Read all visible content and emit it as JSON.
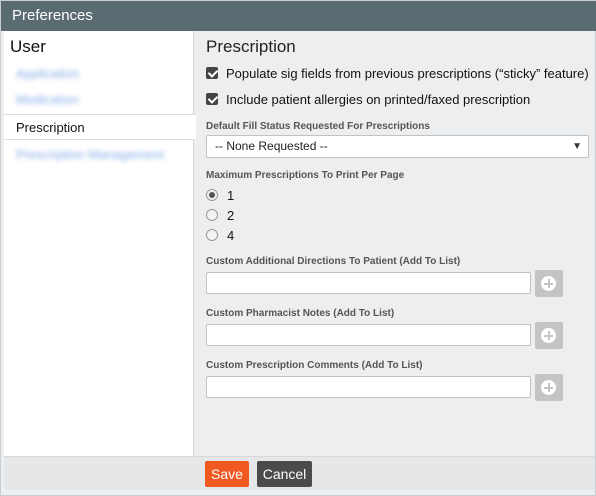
{
  "window": {
    "title": "Preferences"
  },
  "sidebar": {
    "heading": "User",
    "items": [
      {
        "label": "Application",
        "state": "blurred"
      },
      {
        "label": "Medication",
        "state": "blurred"
      },
      {
        "label": "Prescription",
        "state": "active"
      },
      {
        "label": "Prescription Management",
        "state": "blurred"
      }
    ]
  },
  "main": {
    "title": "Prescription",
    "checkboxes": [
      {
        "label": "Populate sig fields from previous prescriptions (“sticky” feature)",
        "checked": true
      },
      {
        "label": "Include patient allergies on printed/faxed prescription",
        "checked": true
      }
    ],
    "fill_status": {
      "label": "Default Fill Status Requested For Prescriptions",
      "value": "-- None Requested --"
    },
    "max_print": {
      "label": "Maximum Prescriptions To Print Per Page",
      "options": [
        "1",
        "2",
        "4"
      ],
      "selected": "1"
    },
    "directions": {
      "label": "Custom Additional Directions To Patient (Add To List)",
      "value": ""
    },
    "pharmacist_notes": {
      "label": "Custom Pharmacist Notes (Add To List)",
      "value": ""
    },
    "rx_comments": {
      "label": "Custom Prescription Comments (Add To List)",
      "value": ""
    }
  },
  "footer": {
    "save_label": "Save",
    "cancel_label": "Cancel"
  },
  "colors": {
    "titlebar": "#5b6b72",
    "save": "#f05a22",
    "cancel": "#4b4b4b",
    "add_button": "#c3c4c6"
  },
  "icons": {
    "caret": "caret-down-icon",
    "add": "plus-circle-icon",
    "check": "checkmark-icon"
  }
}
